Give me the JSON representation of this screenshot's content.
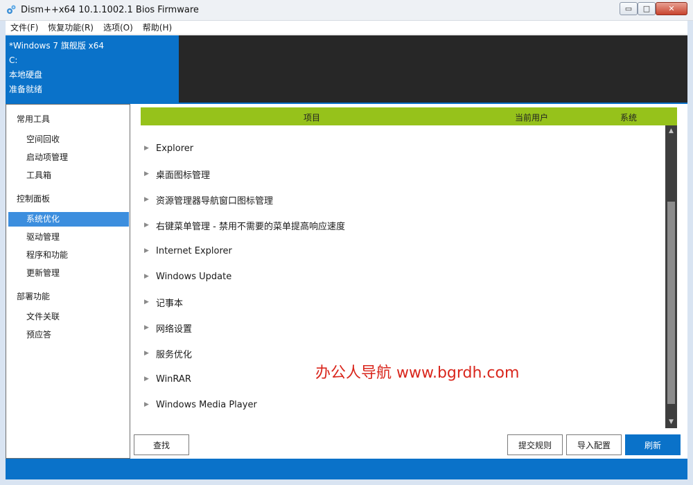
{
  "window": {
    "title": "Dism++x64 10.1.1002.1 Bios Firmware",
    "minimize_glyph": "▭",
    "maximize_glyph": "□",
    "close_glyph": "✕"
  },
  "menu": [
    "文件(F)",
    "恢复功能(R)",
    "选项(O)",
    "帮助(H)"
  ],
  "info": {
    "os": "*Windows 7 旗舰版 x64",
    "drive": "C:",
    "disk": "本地硬盘",
    "status": "准备就绪"
  },
  "sidebar": {
    "groups": [
      {
        "label": "常用工具",
        "items": [
          "空间回收",
          "启动项管理",
          "工具箱"
        ]
      },
      {
        "label": "控制面板",
        "items": [
          "系统优化",
          "驱动管理",
          "程序和功能",
          "更新管理"
        ]
      },
      {
        "label": "部署功能",
        "items": [
          "文件关联",
          "预应答"
        ]
      }
    ],
    "active_item": "系统优化"
  },
  "table_header": {
    "item": "项目",
    "current_user": "当前用户",
    "system": "系统"
  },
  "list_items": [
    "Explorer",
    "桌面图标管理",
    "资源管理器导航窗口图标管理",
    "右键菜单管理 - 禁用不需要的菜单提高响应速度",
    "Internet Explorer",
    "Windows Update",
    "记事本",
    "网络设置",
    "服务优化",
    "WinRAR",
    "Windows Media Player"
  ],
  "watermark": "办公人导航 www.bgrdh.com",
  "buttons": {
    "find": "查找",
    "submit_rule": "提交规则",
    "import_config": "导入配置",
    "refresh": "刷新"
  },
  "colors": {
    "accent_blue": "#0a72c9",
    "header_green": "#96c21b",
    "dark_panel": "#272727",
    "watermark_red": "#d9261c"
  },
  "icons": {
    "app": "gear-icon",
    "expand": "triangle-right-icon",
    "scroll_up": "triangle-up-icon",
    "scroll_down": "triangle-down-icon"
  }
}
